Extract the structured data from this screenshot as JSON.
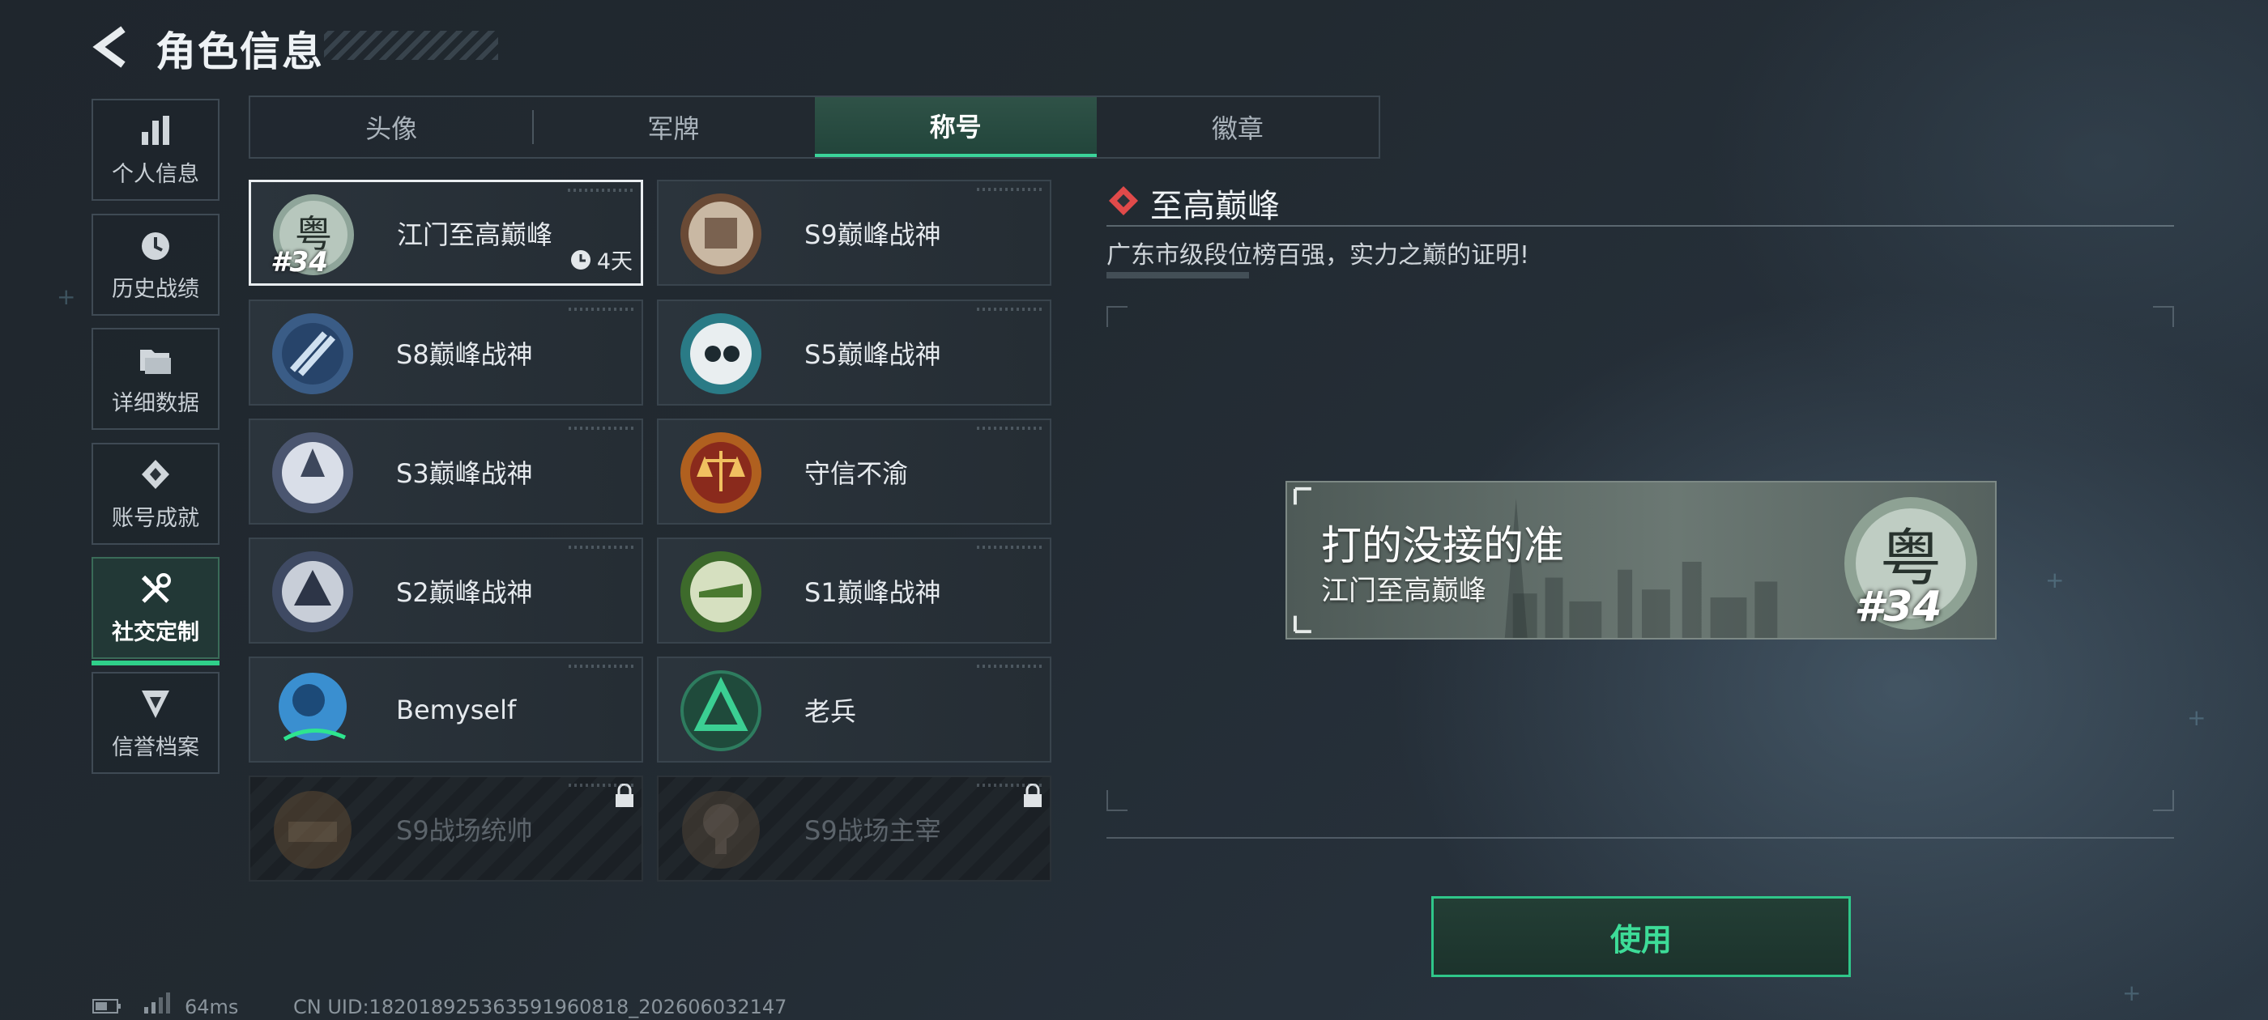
{
  "header": {
    "title": "角色信息"
  },
  "sidebar": {
    "items": [
      {
        "label": "个人信息",
        "icon": "bar-chart-icon"
      },
      {
        "label": "历史战绩",
        "icon": "history-clock-icon"
      },
      {
        "label": "详细数据",
        "icon": "folder-icon"
      },
      {
        "label": "账号成就",
        "icon": "achievement-icon"
      },
      {
        "label": "社交定制",
        "icon": "tools-icon",
        "active": true
      },
      {
        "label": "信誉档案",
        "icon": "credit-badge-icon"
      }
    ]
  },
  "tabs": [
    {
      "label": "头像"
    },
    {
      "label": "军牌"
    },
    {
      "label": "称号",
      "active": true
    },
    {
      "label": "徽章"
    }
  ],
  "titles": [
    {
      "name": "江门至高巅峰",
      "rank": "#34",
      "timer": "4天",
      "selected": true
    },
    {
      "name": "S9巅峰战神"
    },
    {
      "name": "S8巅峰战神"
    },
    {
      "name": "S5巅峰战神"
    },
    {
      "name": "S3巅峰战神"
    },
    {
      "name": "守信不渝"
    },
    {
      "name": "S2巅峰战神"
    },
    {
      "name": "S1巅峰战神"
    },
    {
      "name": "Bemyself"
    },
    {
      "name": "老兵"
    },
    {
      "name": "S9战场统帅",
      "locked": true
    },
    {
      "name": "S9战场主宰",
      "locked": true
    }
  ],
  "detail": {
    "title": "至高巅峰",
    "description": "广东市级段位榜百强，实力之巅的证明!"
  },
  "preview": {
    "player_name": "打的没接的准",
    "title_name": "江门至高巅峰",
    "rank": "#34"
  },
  "actions": {
    "use_label": "使用"
  },
  "footer": {
    "ping": "64ms",
    "uid": "CN UID:18201892536359196081​8_202606032147"
  },
  "colors": {
    "accent": "#2fd08a",
    "accent_text": "#3ddc98",
    "diamond": "#e04a4a"
  }
}
